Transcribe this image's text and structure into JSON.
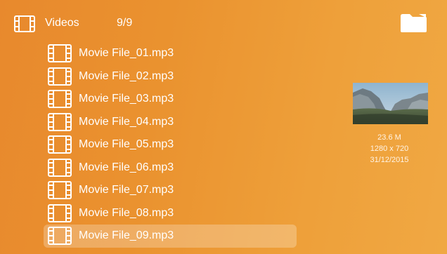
{
  "header": {
    "icon": "film-strip-icon",
    "title": "Videos",
    "count": "9/9",
    "folder_icon": "folder-icon"
  },
  "files": [
    {
      "label": "Movie File_01.mp3",
      "icon": "film-strip-icon",
      "selected": false
    },
    {
      "label": "Movie File_02.mp3",
      "icon": "film-strip-icon",
      "selected": false
    },
    {
      "label": "Movie File_03.mp3",
      "icon": "film-strip-icon",
      "selected": false
    },
    {
      "label": "Movie File_04.mp3",
      "icon": "film-strip-icon",
      "selected": false
    },
    {
      "label": "Movie File_05.mp3",
      "icon": "film-strip-icon",
      "selected": false
    },
    {
      "label": "Movie File_06.mp3",
      "icon": "film-strip-icon",
      "selected": false
    },
    {
      "label": "Movie File_07.mp3",
      "icon": "film-strip-icon",
      "selected": false
    },
    {
      "label": "Movie File_08.mp3",
      "icon": "film-strip-icon",
      "selected": false
    },
    {
      "label": "Movie File_09.mp3",
      "icon": "film-strip-icon",
      "selected": true
    }
  ],
  "preview": {
    "thumbnail": "mountain-landscape-thumbnail",
    "size": "23.6 M",
    "resolution": "1280 x 720",
    "date": "31/12/2015"
  },
  "colors": {
    "background_start": "#e8892d",
    "background_end": "#f0a843",
    "text": "#ffffff"
  }
}
